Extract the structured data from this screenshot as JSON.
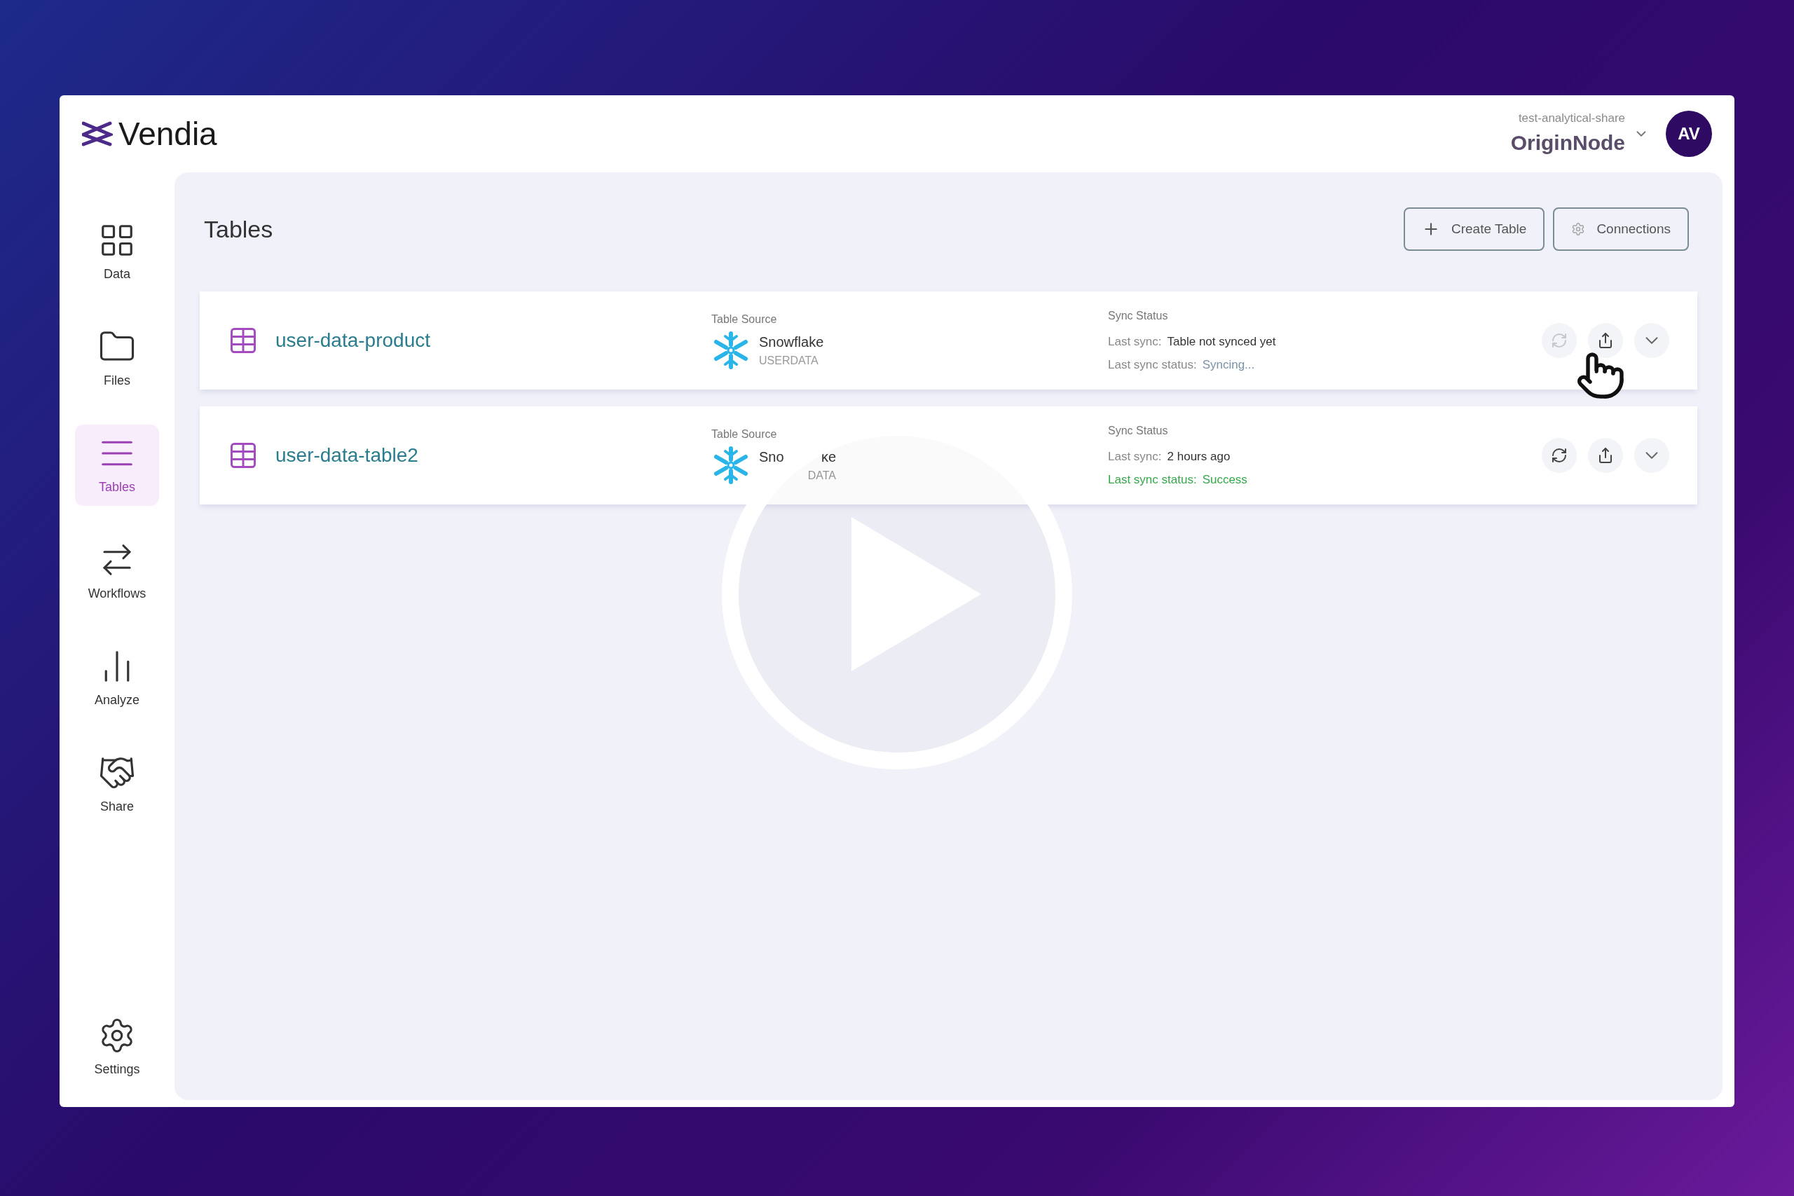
{
  "brand": {
    "name": "Vendia"
  },
  "node": {
    "workspace": "test-analytical-share",
    "name": "OriginNode"
  },
  "avatar": {
    "initials": "AV"
  },
  "sidebar": {
    "items": [
      {
        "label": "Data",
        "kind": "data",
        "selected": false
      },
      {
        "label": "Files",
        "kind": "files",
        "selected": false
      },
      {
        "label": "Tables",
        "kind": "tables",
        "selected": true
      },
      {
        "label": "Workflows",
        "kind": "workflows",
        "selected": false
      },
      {
        "label": "Analyze",
        "kind": "analyze",
        "selected": false
      },
      {
        "label": "Share",
        "kind": "share",
        "selected": false
      }
    ],
    "footer": {
      "label": "Settings"
    }
  },
  "page": {
    "title": "Tables",
    "buttons": [
      {
        "label": "Create Table",
        "kind": "create"
      },
      {
        "label": "Connections",
        "kind": "connections"
      }
    ]
  },
  "rows": [
    {
      "name": "user-data-product",
      "source_heading": "Table Source",
      "source": [
        "Snowflake"
      ],
      "source_detail": [
        "USERDATA"
      ],
      "covered": false,
      "sync_heading": "Sync Status",
      "last_sync_label": "Last sync:",
      "last_sync": "Table not synced yet",
      "status_label": "Last sync status:",
      "status": "Syncing...",
      "kind": "syncing",
      "sync_disabled": true
    },
    {
      "name": "user-data-table2",
      "source_heading": "Table Source",
      "source": [
        "Sno",
        "ke"
      ],
      "source_detail": [
        "DATA"
      ],
      "covered": true,
      "sync_heading": "Sync Status",
      "last_sync_label": "Last sync:",
      "last_sync": "2 hours ago",
      "status_label": "Last sync status:",
      "status": "Success",
      "kind": "success",
      "sync_disabled": false
    }
  ]
}
